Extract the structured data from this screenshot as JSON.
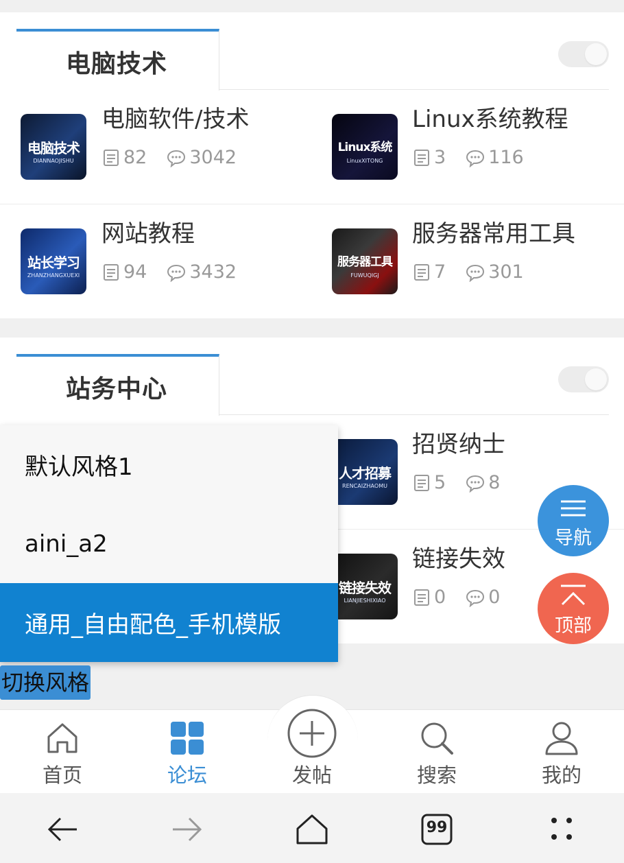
{
  "sections": [
    {
      "title": "电脑技术",
      "forums": [
        {
          "name": "电脑软件/技术",
          "threads": "82",
          "posts": "3042",
          "thumb_main": "电脑技术",
          "thumb_sub": "DIANNAOJISHU"
        },
        {
          "name": "Linux系统教程",
          "threads": "3",
          "posts": "116",
          "thumb_main": "Linux系统",
          "thumb_sub": "LinuxXITONG"
        },
        {
          "name": "网站教程",
          "threads": "94",
          "posts": "3432",
          "thumb_main": "站长学习",
          "thumb_sub": "ZHANZHANGXUEXI"
        },
        {
          "name": "服务器常用工具",
          "threads": "7",
          "posts": "301",
          "thumb_main": "服务器工具",
          "thumb_sub": "FUWUQIGJ"
        }
      ]
    },
    {
      "title": "站务中心",
      "forums": [
        {
          "name": "招贤纳士",
          "threads": "5",
          "posts": "8",
          "thumb_main": "人才招募",
          "thumb_sub": "RENCAIZHAOMU"
        },
        {
          "name": "链接失效",
          "threads": "0",
          "posts": "0",
          "thumb_main": "链接失效",
          "thumb_sub": "LIANJIESHIXIAO"
        }
      ]
    }
  ],
  "style_menu": {
    "items": [
      "默认风格1",
      "aini_a2",
      "通用_自由配色_手机模版"
    ],
    "active_index": 2
  },
  "switch_style_label": "切换风格",
  "fabs": {
    "nav_label": "导航",
    "top_label": "顶部"
  },
  "bottom_nav": {
    "items": [
      {
        "label": "首页",
        "icon": "home-icon"
      },
      {
        "label": "论坛",
        "icon": "grid-icon"
      },
      {
        "label": "发帖",
        "icon": "plus-circle-icon"
      },
      {
        "label": "搜索",
        "icon": "search-icon"
      },
      {
        "label": "我的",
        "icon": "user-icon"
      }
    ],
    "active_index": 1
  },
  "browser_bar": {
    "tab_count": "99",
    "icons": [
      "back-arrow-icon",
      "forward-arrow-icon",
      "home-icon",
      "tabs-icon",
      "more-icon"
    ]
  },
  "colors": {
    "accent": "#3b8ed4",
    "menu_active": "#1182d0",
    "top_fab": "#f06650",
    "nav_fab": "#3b93dc"
  }
}
